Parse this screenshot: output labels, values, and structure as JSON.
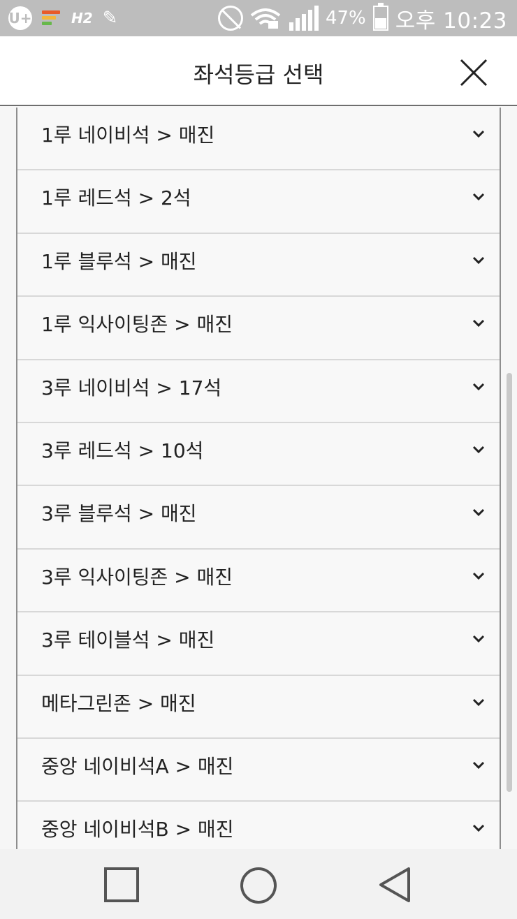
{
  "status_bar": {
    "carrier_badge": "U+",
    "apps_badge": "H2",
    "battery_percent": "47%",
    "battery_level": 0.47,
    "time": "오후 10:23"
  },
  "header": {
    "title": "좌석등급 선택"
  },
  "seat_grades": [
    {
      "label": "1루 네이비석 > 매진"
    },
    {
      "label": "1루 레드석 > 2석"
    },
    {
      "label": "1루 블루석 > 매진"
    },
    {
      "label": "1루 익사이팅존 > 매진"
    },
    {
      "label": "3루 네이비석 > 17석"
    },
    {
      "label": "3루 레드석 > 10석"
    },
    {
      "label": "3루 블루석 > 매진"
    },
    {
      "label": "3루 익사이팅존 > 매진"
    },
    {
      "label": "3루 테이블석 > 매진"
    },
    {
      "label": "메타그린존 > 매진"
    },
    {
      "label": "중앙 네이비석A > 매진"
    },
    {
      "label": "중앙 네이비석B > 매진"
    }
  ],
  "icons": {
    "close": "close-icon",
    "row_expand": "chevron-down-icon",
    "nav_back": "back-triangle-icon",
    "nav_home": "home-circle-icon",
    "nav_recent": "recent-apps-square-icon"
  },
  "colors": {
    "status_bar_bg": "#bdbdbd",
    "header_bg": "#ffffff",
    "row_bg": "#f8f8f8",
    "text": "#222222",
    "nav_icon": "#555555"
  }
}
